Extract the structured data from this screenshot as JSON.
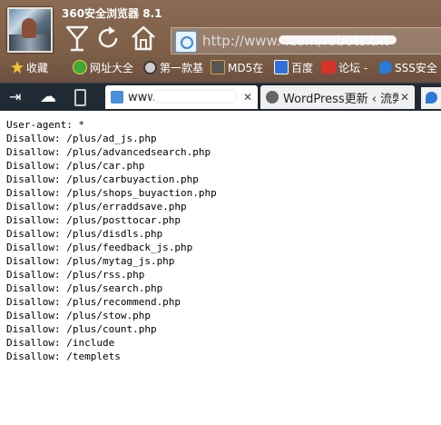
{
  "window": {
    "title": "360安全浏览器 8.1"
  },
  "toolbar": {
    "address": "http://www.                      .com/robots.txt"
  },
  "bookmarks": [
    {
      "label": "收藏",
      "icon": "star-icon",
      "color": "#f2c233"
    },
    {
      "label": "网址大全",
      "icon": "plus-circle-icon",
      "color": "#3fa83a"
    },
    {
      "label": "第一款基",
      "icon": "search-icon",
      "color": "#cfcfcf"
    },
    {
      "label": "MD5在",
      "icon": "md5-icon",
      "color": "#555555"
    },
    {
      "label": "百度",
      "icon": "baidu-paw-icon",
      "color": "#2f6fde"
    },
    {
      "label": "论坛 -",
      "icon": "slc-icon",
      "color": "#d8332b"
    },
    {
      "label": "SSS安全",
      "icon": "s-logo-icon",
      "color": "#2a79d6"
    }
  ],
  "tabs": [
    {
      "label": "www.",
      "active": true,
      "favicon_color": "#4a90d9"
    },
    {
      "label": "WordPress更新 ‹ 流弊",
      "active": false,
      "favicon_color": "#666666"
    }
  ],
  "content": {
    "lines": [
      "User-agent: *",
      "Disallow: /plus/ad_js.php",
      "Disallow: /plus/advancedsearch.php",
      "Disallow: /plus/car.php",
      "Disallow: /plus/carbuyaction.php",
      "Disallow: /plus/shops_buyaction.php",
      "Disallow: /plus/erraddsave.php",
      "Disallow: /plus/posttocar.php",
      "Disallow: /plus/disdls.php",
      "Disallow: /plus/feedback_js.php",
      "Disallow: /plus/mytag_js.php",
      "Disallow: /plus/rss.php",
      "Disallow: /plus/search.php",
      "Disallow: /plus/recommend.php",
      "Disallow: /plus/stow.php",
      "Disallow: /plus/count.php",
      "Disallow: /include",
      "Disallow: /templets"
    ]
  }
}
